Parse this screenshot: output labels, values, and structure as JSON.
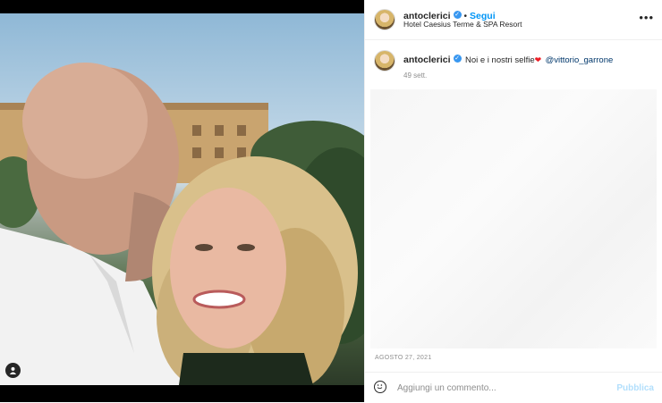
{
  "post": {
    "photo_alt_icon": "user-tag-icon"
  },
  "header": {
    "username": "antoclerici",
    "separator": "•",
    "follow_label": "Segui",
    "location": "Hotel Caesius Terme & SPA Resort",
    "more_label": "•••"
  },
  "caption": {
    "username": "antoclerici",
    "text": "Noi e i nostri selfie",
    "heart": "❤",
    "mention": "@vittorio_garrone",
    "time": "49 sett."
  },
  "footer": {
    "date": "AGOSTO 27, 2021",
    "comment_placeholder": "Aggiungi un commento...",
    "publish_label": "Pubblica"
  },
  "colors": {
    "accent": "#0095f6",
    "verified": "#3897f0",
    "publish_disabled": "#b2dffc"
  }
}
